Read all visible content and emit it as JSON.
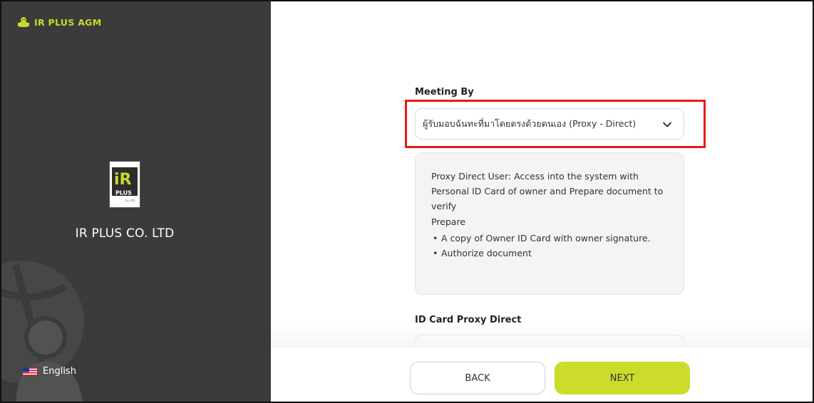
{
  "brand": {
    "name": "IR PLUS AGM",
    "accent": "#c9da2b"
  },
  "company": {
    "name": "IR PLUS CO. LTD",
    "logo_text_top": "iR",
    "logo_text_bottom": "PLUS",
    "logo_sub": "by efin"
  },
  "language": {
    "label": "English",
    "flag_icon": "us-flag-icon"
  },
  "meeting_by": {
    "label": "Meeting By",
    "selected": "ผู้รับมอบฉันทะที่มาโดยตรงด้วยตนเอง (Proxy - Direct)"
  },
  "info": {
    "description": "Proxy Direct User: Access into the system with Personal ID Card of owner and Prepare document to verify",
    "prepare_label": "Prepare",
    "items": [
      "A copy of Owner ID Card with owner signature.",
      "Authorize document"
    ]
  },
  "id_card": {
    "label": "ID Card Proxy Direct"
  },
  "buttons": {
    "back": "BACK",
    "next": "NEXT"
  },
  "colors": {
    "sidebar": "#3b3b3b",
    "next_button": "#cbdc2b",
    "highlight": "#e41b17"
  }
}
